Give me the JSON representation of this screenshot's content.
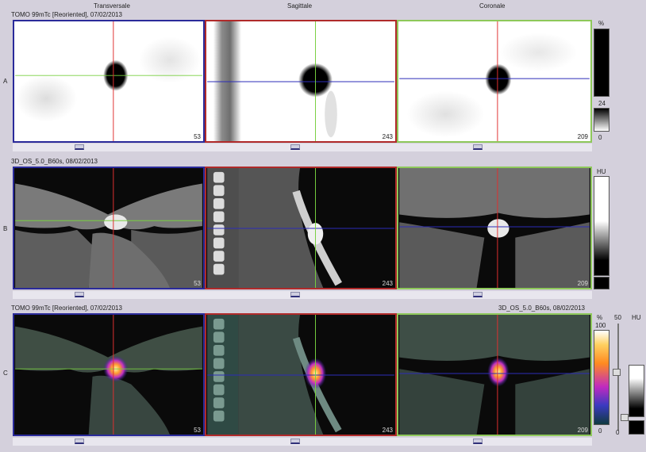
{
  "headers": {
    "transversale": "Transversale",
    "sagittale": "Sagittale",
    "coronale": "Coronale"
  },
  "row_a": {
    "label": "A",
    "series": "TOMO 99mTc [Reoriented], 07/02/2013",
    "slices": [
      "53",
      "243",
      "209"
    ]
  },
  "row_b": {
    "label": "B",
    "series": "3D_OS_5.0_B60s, 08/02/2013",
    "slices": [
      "53",
      "243",
      "209"
    ]
  },
  "row_c": {
    "label": "C",
    "series_left": "TOMO 99mTc [Reoriented], 07/02/2013",
    "series_right": "3D_OS_5.0_B60s, 08/02/2013",
    "slices": [
      "53",
      "243",
      "209"
    ]
  },
  "scale_a": {
    "unit": "%",
    "mid": "24",
    "min": "0"
  },
  "scale_b": {
    "unit": "HU"
  },
  "scale_c": {
    "unit_pct": "%",
    "max": "100",
    "min": "0",
    "fifty": "50",
    "unit_hu": "HU",
    "blend_min": "0"
  },
  "colors": {
    "transversal_frame": "#2a2a9a",
    "sagittal_frame": "#b02a2a",
    "coronal_frame": "#8ec85a",
    "crosshair_red": "#e03030",
    "crosshair_green": "#78d040",
    "crosshair_blue": "#2c2cb8"
  },
  "slider_positions": {
    "horizontal": [
      0.55,
      0.55,
      0.55
    ],
    "blend": 0.5
  }
}
